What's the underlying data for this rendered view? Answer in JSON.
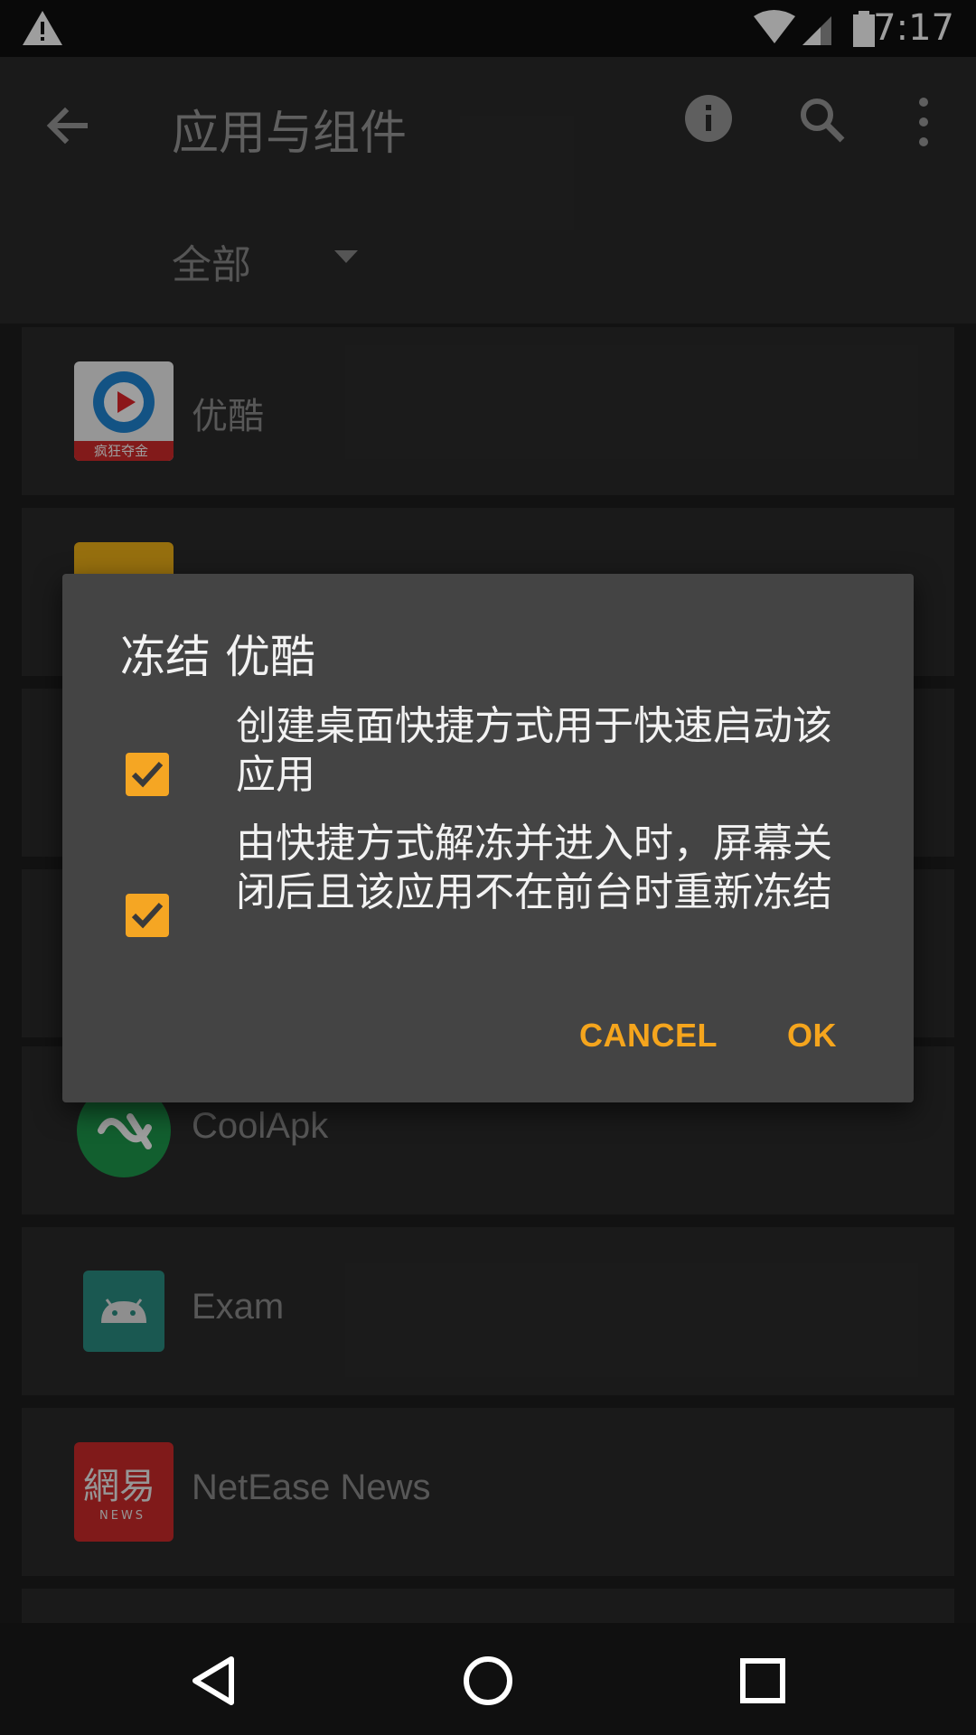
{
  "status_bar": {
    "time": "7:17"
  },
  "app_bar": {
    "title": "应用与组件",
    "filter_label": "全部"
  },
  "apps": [
    {
      "name": "优酷",
      "icon": "youku-icon",
      "icon_caption": "疯狂夺金"
    },
    {
      "name": "",
      "icon": "yellow-app-icon"
    },
    {
      "name": "CoolApk",
      "icon": "coolapk-icon"
    },
    {
      "name": "Exam",
      "icon": "android-icon"
    },
    {
      "name": "NetEase News",
      "icon": "netease-news-icon",
      "icon_caption": "網易",
      "icon_sub": "NEWS"
    }
  ],
  "dialog": {
    "title": "冻结 优酷",
    "options": [
      {
        "checked": true,
        "text": "创建桌面快捷方式用于快速启动该应用"
      },
      {
        "checked": true,
        "text": "由快捷方式解冻并进入时，屏幕关闭后且该应用不在前台时重新冻结"
      }
    ],
    "cancel_label": "CANCEL",
    "ok_label": "OK"
  },
  "colors": {
    "accent": "#f5a623",
    "dialog_bg": "#444444",
    "bg": "#2b2b2b"
  }
}
